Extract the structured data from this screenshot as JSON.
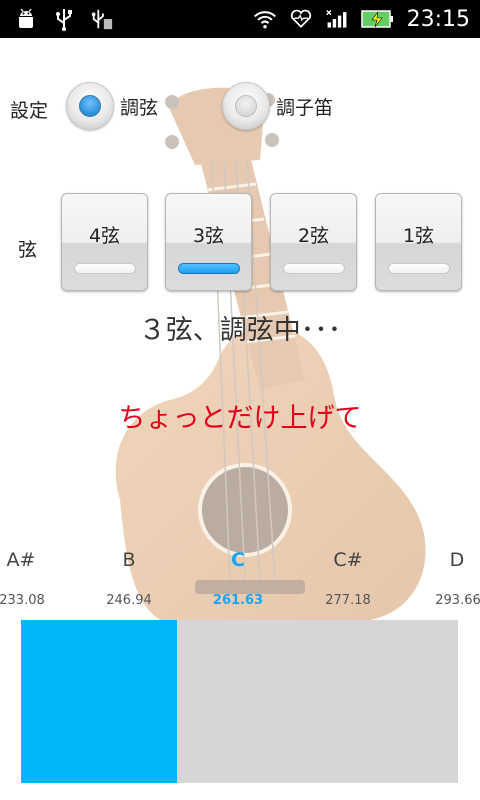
{
  "statusbar": {
    "time": "23:15",
    "icons": [
      "android-debug-icon",
      "usb-icon",
      "usb-storage-icon",
      "wifi-icon",
      "heart-monitor-icon",
      "signal-icon",
      "battery-charging-icon"
    ]
  },
  "settings": {
    "label": "設定",
    "options": [
      {
        "label": "調弦",
        "selected": true
      },
      {
        "label": "調子笛",
        "selected": false
      }
    ]
  },
  "strings": {
    "label": "弦",
    "buttons": [
      {
        "label": "4弦",
        "active": false
      },
      {
        "label": "3弦",
        "active": true
      },
      {
        "label": "2弦",
        "active": false
      },
      {
        "label": "1弦",
        "active": false
      }
    ]
  },
  "status_text": "３弦、調弦中･･･",
  "instruction_text": "ちょっとだけ上げて",
  "notes": [
    {
      "name": "A#",
      "freq": "233.08",
      "active": false
    },
    {
      "name": "B",
      "freq": "246.94",
      "active": false
    },
    {
      "name": "C",
      "freq": "261.63",
      "active": true
    },
    {
      "name": "C#",
      "freq": "277.18",
      "active": false
    },
    {
      "name": "D",
      "freq": "293.66",
      "active": false
    }
  ],
  "meter": {
    "fill_fraction": 0.356,
    "fill_color": "#00b5f8",
    "track_color": "#d6d5d7"
  },
  "colors": {
    "accent": "#19a5f5",
    "warning": "#e0001a"
  }
}
